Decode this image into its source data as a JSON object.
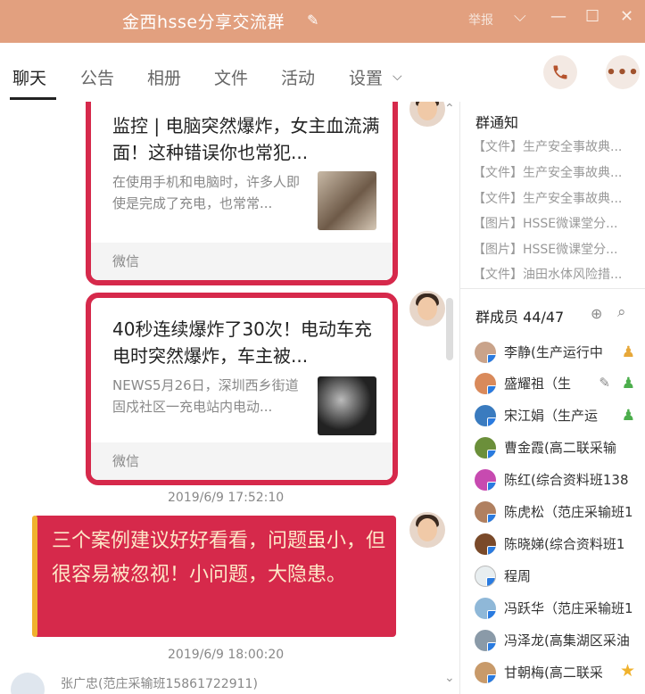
{
  "window": {
    "title": "金西hsse分享交流群",
    "report_label": "举报"
  },
  "tabs": [
    {
      "label": "聊天"
    },
    {
      "label": "公告"
    },
    {
      "label": "相册"
    },
    {
      "label": "文件"
    },
    {
      "label": "活动"
    },
    {
      "label": "设置"
    }
  ],
  "messages": {
    "card1": {
      "title": "监控 | 电脑突然爆炸，女主血流满面！这种错误你也常犯...",
      "desc": "在使用手机和电脑时，许多人即使是完成了充电，也常常...",
      "source": "微信"
    },
    "card2": {
      "title": "40秒连续爆炸了30次！电动车充电时突然爆炸，车主被...",
      "desc": "NEWS5月26日，深圳西乡街道固戍社区一充电站内电动...",
      "source": "微信"
    },
    "time1": "2019/6/9 17:52:10",
    "text_message": "三个案例建议好好看看，问题虽小，但很容易被忽视！小问题，大隐患。",
    "time2": "2019/6/9 18:00:20",
    "next_sender": "张广忠(范庄采输班15861722911)"
  },
  "sidebar": {
    "notice_title": "群通知",
    "notices": [
      "【文件】生产安全事故典...",
      "【文件】生产安全事故典...",
      "【文件】生产安全事故典...",
      "【图片】HSSE微课堂分...",
      "【图片】HSSE微课堂分...",
      "【文件】油田水体风险措..."
    ],
    "members_title": "群成员 44/47",
    "members": [
      {
        "name": "李静(生产运行中",
        "role": "admin"
      },
      {
        "name": "盛耀祖（生",
        "role": "admin"
      },
      {
        "name": "宋江娟（生产运",
        "role": "admin"
      },
      {
        "name": "曹金霞(高二联采输",
        "role": ""
      },
      {
        "name": "陈红(综合资料班138",
        "role": ""
      },
      {
        "name": "陈虎松（范庄采输班1",
        "role": ""
      },
      {
        "name": "陈晓娣(综合资料班1",
        "role": ""
      },
      {
        "name": "程周",
        "role": ""
      },
      {
        "name": "冯跃华（范庄采输班1",
        "role": ""
      },
      {
        "name": "冯泽龙(高集湖区采油",
        "role": ""
      },
      {
        "name": "甘朝梅(高二联采",
        "role": "owner"
      }
    ]
  },
  "colors": {
    "titlebar": "#e2a07f",
    "card_border": "#d6294b",
    "message_bg": "#d6294b",
    "message_text": "#fde8c8",
    "accent_bar": "#f0b22d"
  }
}
